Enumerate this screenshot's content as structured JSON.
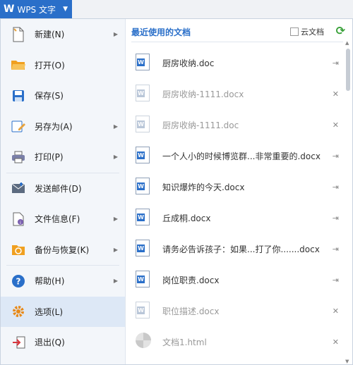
{
  "app": {
    "logo": "W",
    "title": "WPS 文字",
    "caret": "▼"
  },
  "menu": [
    {
      "label": "新建(N)",
      "icon": "new-file-icon",
      "submenu": true
    },
    {
      "label": "打开(O)",
      "icon": "open-folder-icon",
      "submenu": false
    },
    {
      "label": "保存(S)",
      "icon": "save-icon",
      "submenu": false
    },
    {
      "label": "另存为(A)",
      "icon": "save-as-icon",
      "submenu": true
    },
    {
      "label": "打印(P)",
      "icon": "print-icon",
      "submenu": true
    },
    {
      "label": "发送邮件(D)",
      "icon": "mail-icon",
      "submenu": false
    },
    {
      "label": "文件信息(F)",
      "icon": "file-info-icon",
      "submenu": true
    },
    {
      "label": "备份与恢复(K)",
      "icon": "backup-icon",
      "submenu": true
    },
    {
      "label": "帮助(H)",
      "icon": "help-icon",
      "submenu": true
    },
    {
      "label": "选项(L)",
      "icon": "options-icon",
      "submenu": false,
      "active": true
    },
    {
      "label": "退出(Q)",
      "icon": "exit-icon",
      "submenu": false
    }
  ],
  "recent": {
    "title": "最近使用的文档",
    "cloud_label": "云文档",
    "refresh_icon": "refresh-icon",
    "files": [
      {
        "name": "厨房收纳.doc",
        "dim": false,
        "action": "⇥",
        "action_icon": "pin-icon"
      },
      {
        "name": "厨房收纳-1111.docx",
        "dim": true,
        "action": "✕",
        "action_icon": "remove-icon"
      },
      {
        "name": "厨房收纳-1111.doc",
        "dim": true,
        "action": "✕",
        "action_icon": "remove-icon"
      },
      {
        "name": "一个人小的时候博览群...非常重要的.docx",
        "dim": false,
        "action": "⇥",
        "action_icon": "pin-icon"
      },
      {
        "name": "知识爆炸的今天.docx",
        "dim": false,
        "action": "⇥",
        "action_icon": "pin-icon"
      },
      {
        "name": "丘成桐.docx",
        "dim": false,
        "action": "⇥",
        "action_icon": "pin-icon"
      },
      {
        "name": "请务必告诉孩子：如果...打了你.......docx",
        "dim": false,
        "action": "⇥",
        "action_icon": "pin-icon"
      },
      {
        "name": "岗位职责.docx",
        "dim": false,
        "action": "⇥",
        "action_icon": "pin-icon"
      },
      {
        "name": "职位描述.docx",
        "dim": true,
        "action": "✕",
        "action_icon": "remove-icon"
      },
      {
        "name": "文档1.html",
        "dim": true,
        "action": "✕",
        "action_icon": "remove-icon",
        "type": "html"
      }
    ]
  },
  "colors": {
    "accent": "#2a6fc9",
    "active_bg": "#dde8f6",
    "menu_bg": "#f3f6fa"
  }
}
